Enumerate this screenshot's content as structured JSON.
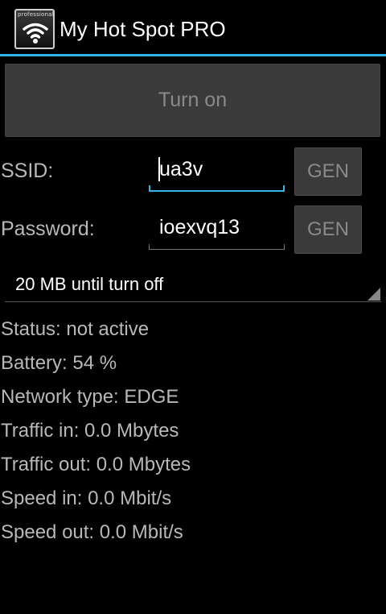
{
  "app": {
    "title": "My Hot Spot PRO",
    "icon_badge": "professional",
    "icon": "wifi-icon"
  },
  "colors": {
    "accent": "#33b5e5",
    "background": "#000000",
    "button": "#3a3a3a"
  },
  "main_button": {
    "label": "Turn on",
    "enabled": false
  },
  "ssid": {
    "label": "SSID:",
    "value": "ua3v",
    "focused": true,
    "gen_label": "GEN"
  },
  "password": {
    "label": "Password:",
    "value": "ioexvq13",
    "focused": false,
    "gen_label": "GEN"
  },
  "limit_spinner": {
    "selected": "20 MB until turn off"
  },
  "stats": [
    "Status: not active",
    "Battery: 54 %",
    "Network type: EDGE",
    "Traffic in: 0.0 Mbytes",
    "Traffic out: 0.0 Mbytes",
    "Speed in: 0.0 Mbit/s",
    "Speed out: 0.0 Mbit/s"
  ]
}
